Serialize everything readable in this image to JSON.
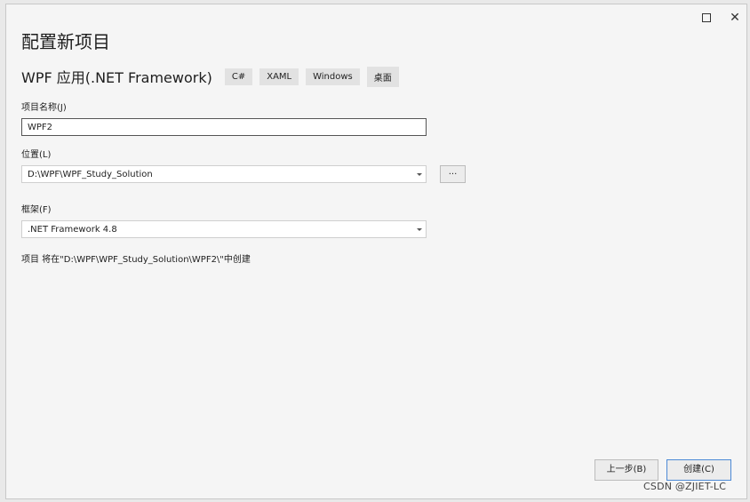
{
  "window": {
    "title": "配置新项目",
    "maximize_icon": "maximize-icon",
    "close_icon": "close-icon",
    "close_glyph": "✕"
  },
  "template": {
    "name": "WPF 应用(.NET Framework)",
    "tags": [
      "C#",
      "XAML",
      "Windows",
      "桌面"
    ]
  },
  "form": {
    "project_name_label": "项目名称(J)",
    "project_name_value": "WPF2",
    "location_label": "位置(L)",
    "location_value": "D:\\WPF\\WPF_Study_Solution",
    "browse_label": "...",
    "framework_label": "框架(F)",
    "framework_value": ".NET Framework 4.8",
    "info_text": "项目 将在\"D:\\WPF\\WPF_Study_Solution\\WPF2\\\"中创建"
  },
  "buttons": {
    "back_label": "上一步(B)",
    "create_label": "创建(C)"
  },
  "watermark": "CSDN @ZJIET-LC",
  "colors": {
    "dialog_bg": "#f5f5f5",
    "accent_border": "#4d8ad6"
  }
}
